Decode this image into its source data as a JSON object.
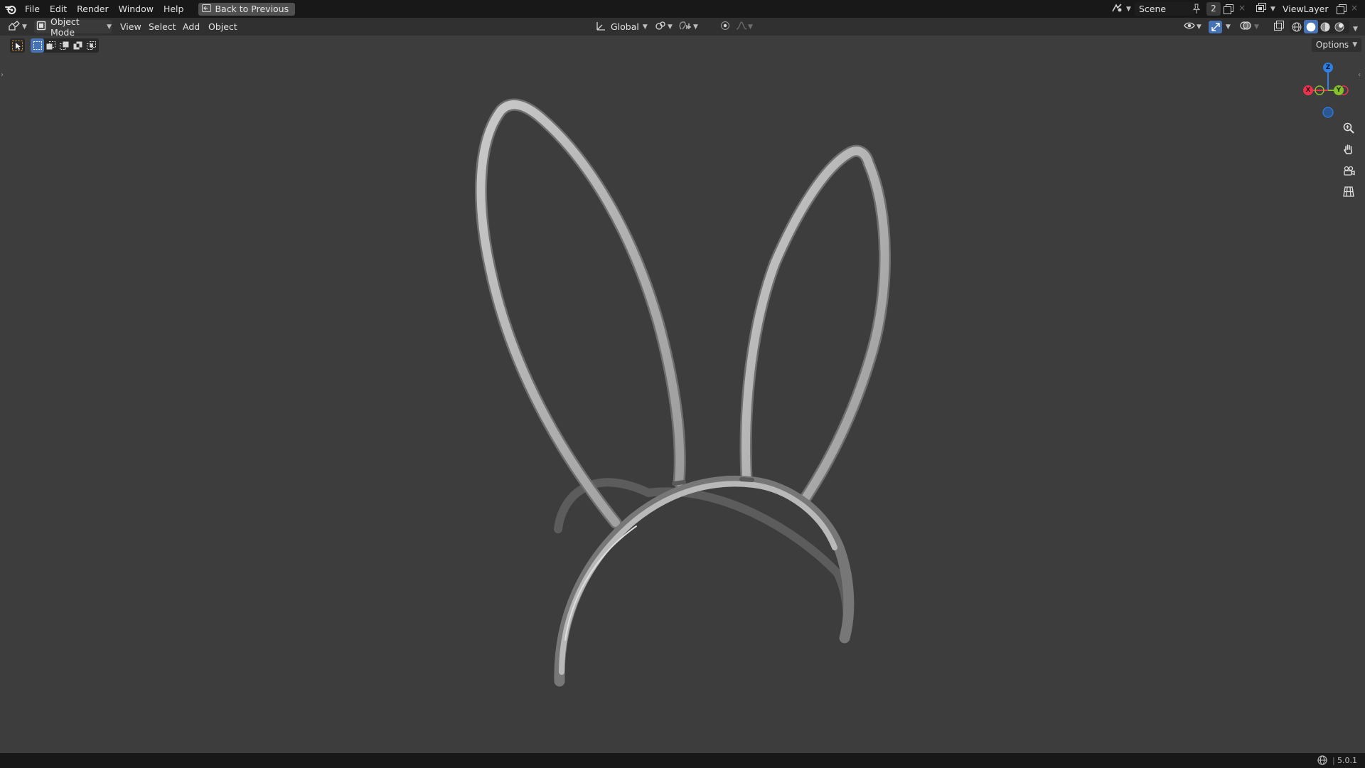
{
  "app": {
    "menus": [
      "File",
      "Edit",
      "Render",
      "Window",
      "Help"
    ],
    "back_button": "Back to Previous",
    "scene_name": "Scene",
    "scene_users": "2",
    "view_layer": "ViewLayer"
  },
  "header": {
    "mode": "Object Mode",
    "menus": [
      "View",
      "Select",
      "Add",
      "Object"
    ],
    "transform_orientation": "Global",
    "options_label": "Options"
  },
  "gizmo": {
    "z_label": "Z",
    "x_label": "X",
    "y_label": "Y",
    "colors": {
      "x": "#e8344e",
      "y": "#86c12d",
      "z": "#2e7fe3"
    }
  },
  "status": {
    "version": "5.0.1"
  },
  "theme": {
    "viewport_bg": "#3d3d3d",
    "topbar_bg": "#181818",
    "header_bg": "#303030",
    "accent": "#4772b3"
  },
  "icons": [
    "blender-logo-icon",
    "back-icon",
    "editor-type-icon",
    "object-mode-icon",
    "transform-icon",
    "pivot-icon",
    "snap-icon",
    "proportional-icon",
    "visibility-icon",
    "gizmo-icon",
    "overlay-icon",
    "xray-icon",
    "wireframe-shading-icon",
    "solid-shading-icon",
    "material-shading-icon",
    "rendered-shading-icon",
    "zoom-icon",
    "pan-hand-icon",
    "camera-icon",
    "ortho-grid-icon",
    "scene-icon",
    "pin-icon",
    "new-scene-icon",
    "viewlayer-icon",
    "new-layer-icon",
    "network-icon"
  ]
}
